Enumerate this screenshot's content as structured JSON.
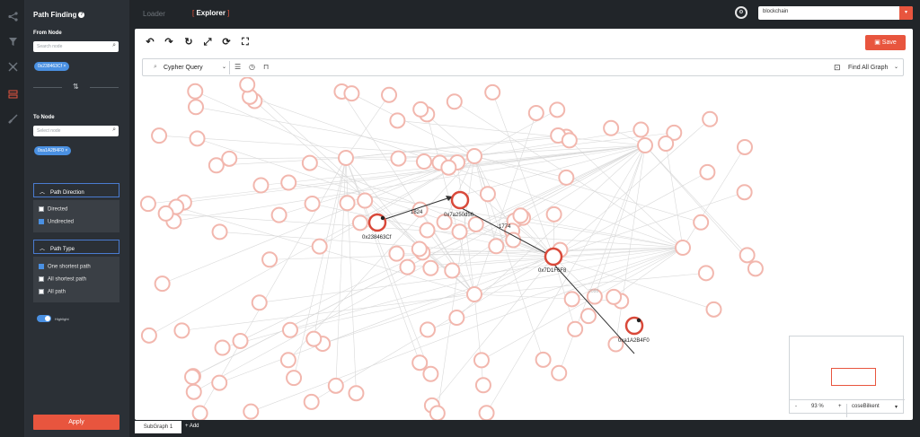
{
  "sidebar_icons": [
    "share-icon",
    "filter-icon",
    "cluster-icon",
    "path-icon",
    "brush-icon"
  ],
  "panel": {
    "title": "Path Finding",
    "from_label": "From Node",
    "from_placeholder": "Search node",
    "from_chip": "0x238463Cf",
    "to_label": "To Node",
    "to_placeholder": "Select node",
    "to_chip": "0xa1A2B4F0",
    "path_direction_title": "Path Direction",
    "directions": [
      {
        "label": "Directed",
        "checked": false
      },
      {
        "label": "Undirected",
        "checked": true
      }
    ],
    "path_type_title": "Path Type",
    "types": [
      {
        "label": "One shortest path",
        "checked": true
      },
      {
        "label": "All shortest path",
        "checked": false
      },
      {
        "label": "All path",
        "checked": false
      }
    ],
    "highlight_label": "Highlight",
    "apply_label": "Apply"
  },
  "topbar": {
    "tabs": [
      "Loader",
      "Explorer"
    ],
    "active_tab": "Explorer",
    "database": "blockchain"
  },
  "canvas": {
    "save_label": "Save",
    "query_mode": "Cypher Query",
    "find_label": "Find All Graph",
    "zoom": "93 %",
    "layout": "coseBilkent"
  },
  "graph": {
    "nodes": [
      {
        "label": "0x238463Cf",
        "role": "source"
      },
      {
        "label": "0x7a250d56",
        "role": "path"
      },
      {
        "label": "0x7D1F6F8",
        "role": "path"
      },
      {
        "label": "0xa1A2B4F0",
        "role": "target"
      }
    ],
    "edges": [
      {
        "label": "1824"
      },
      {
        "label": "1774"
      },
      {
        "label": "2088"
      }
    ]
  },
  "bottom": {
    "subgraph_tab": "SubGraph 1",
    "add_label": "+ Add"
  },
  "colors": {
    "accent": "#e8553e",
    "select": "#4a90e2",
    "dark": "#212529"
  }
}
